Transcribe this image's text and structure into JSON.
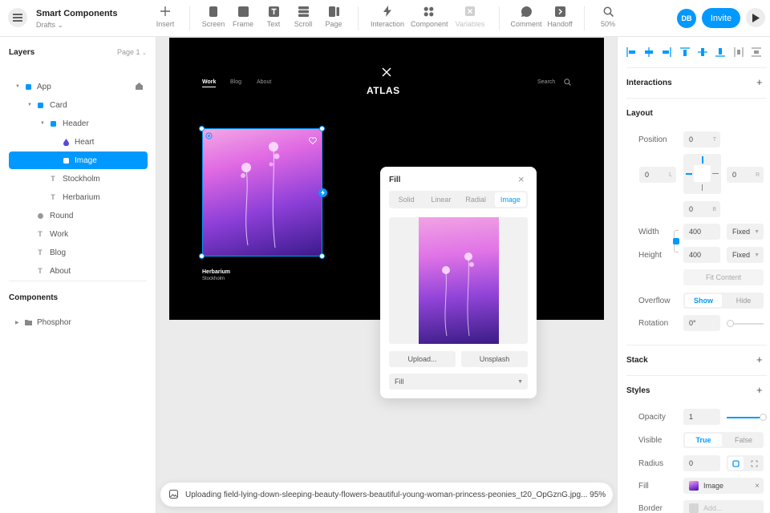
{
  "app": {
    "title": "Smart Components",
    "subtitle": "Drafts ⌄"
  },
  "toolbar": {
    "insert": "Insert",
    "screen": "Screen",
    "frame": "Frame",
    "text": "Text",
    "scroll": "Scroll",
    "page": "Page",
    "interaction": "Interaction",
    "component": "Component",
    "variables": "Variables",
    "comment": "Comment",
    "handoff": "Handoff",
    "zoom": "50%"
  },
  "user": {
    "initials": "DB",
    "invite": "Invite"
  },
  "layers": {
    "title": "Layers",
    "page": "Page 1",
    "items": [
      "App",
      "Card",
      "Header",
      "Heart",
      "Image",
      "Stockholm",
      "Herbarium",
      "Round",
      "Work",
      "Blog",
      "About"
    ],
    "components_title": "Components",
    "components": [
      "Phosphor"
    ]
  },
  "canvas": {
    "nav": [
      "Work",
      "Blog",
      "About"
    ],
    "brand": "ATLAS",
    "search": "Search",
    "card_title": "Herbarium",
    "card_sub": "Stockholm"
  },
  "fill_popup": {
    "title": "Fill",
    "tabs": [
      "Solid",
      "Linear",
      "Radial",
      "Image"
    ],
    "active_tab": "Image",
    "upload": "Upload...",
    "unsplash": "Unsplash",
    "mode": "Fill"
  },
  "toast": {
    "text": "Uploading field-lying-down-sleeping-beauty-flowers-beautiful-young-woman-princess-peonies_t20_OpGznG.jpg... 95%",
    "progress": 0.95
  },
  "props": {
    "interactions": "Interactions",
    "layout": "Layout",
    "position": "Position",
    "pos_t": "0",
    "pos_l": "0",
    "pos_r": "0",
    "pos_b": "0",
    "suf_t": "T",
    "suf_l": "L",
    "suf_r": "R",
    "suf_b": "B",
    "width": "Width",
    "width_val": "400",
    "width_mode": "Fixed",
    "height": "Height",
    "height_val": "400",
    "height_mode": "Fixed",
    "fit_content": "Fit Content",
    "overflow": "Overflow",
    "overflow_show": "Show",
    "overflow_hide": "Hide",
    "rotation": "Rotation",
    "rotation_val": "0°",
    "stack": "Stack",
    "styles": "Styles",
    "opacity": "Opacity",
    "opacity_val": "1",
    "visible": "Visible",
    "visible_true": "True",
    "visible_false": "False",
    "radius": "Radius",
    "radius_val": "0",
    "fill": "Fill",
    "fill_val": "Image",
    "border": "Border",
    "border_val": "Add..."
  },
  "accent": "#0099ff"
}
